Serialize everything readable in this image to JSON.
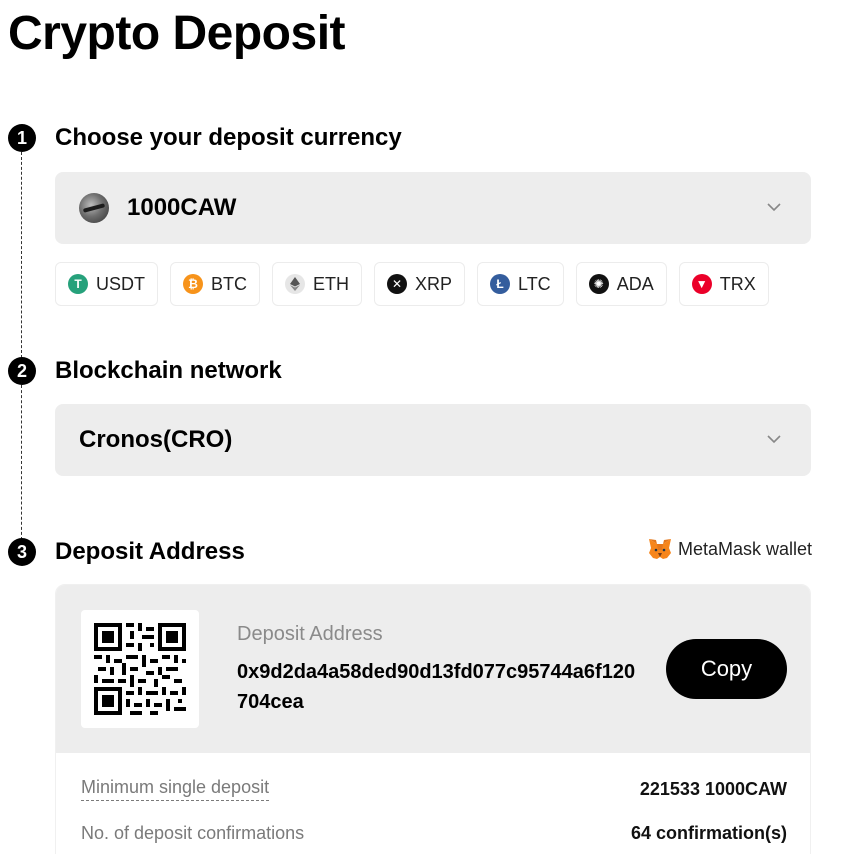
{
  "page": {
    "title": "Crypto Deposit"
  },
  "steps": [
    {
      "number": "1",
      "title": "Choose your deposit currency"
    },
    {
      "number": "2",
      "title": "Blockchain network"
    },
    {
      "number": "3",
      "title": "Deposit Address"
    }
  ],
  "currency_select": {
    "value": "1000CAW",
    "icon": "caw-coin-icon"
  },
  "quick_currencies": [
    {
      "label": "USDT",
      "icon": "usdt-icon",
      "color": "#26a17b"
    },
    {
      "label": "BTC",
      "icon": "btc-icon",
      "color": "#f7931a"
    },
    {
      "label": "ETH",
      "icon": "eth-icon",
      "color": "#8c8c8c"
    },
    {
      "label": "XRP",
      "icon": "xrp-icon",
      "color": "#111111"
    },
    {
      "label": "LTC",
      "icon": "ltc-icon",
      "color": "#345d9d"
    },
    {
      "label": "ADA",
      "icon": "ada-icon",
      "color": "#111111"
    },
    {
      "label": "TRX",
      "icon": "trx-icon",
      "color": "#eb0029"
    }
  ],
  "network_select": {
    "value": "Cronos(CRO)"
  },
  "metamask": {
    "label": "MetaMask wallet",
    "icon": "metamask-fox-icon"
  },
  "deposit": {
    "address_label": "Deposit Address",
    "address": "0x9d2da4a58ded90d13fd077c95744a6f120704cea",
    "copy_label": "Copy"
  },
  "info": {
    "min_label": "Minimum single deposit",
    "min_value": "221533 1000CAW",
    "confirm_label": "No. of deposit confirmations",
    "confirm_value": "64 confirmation(s)"
  },
  "colors": {
    "accent": "#000000",
    "panel": "#ededed",
    "muted_text": "#8a8a8a"
  }
}
